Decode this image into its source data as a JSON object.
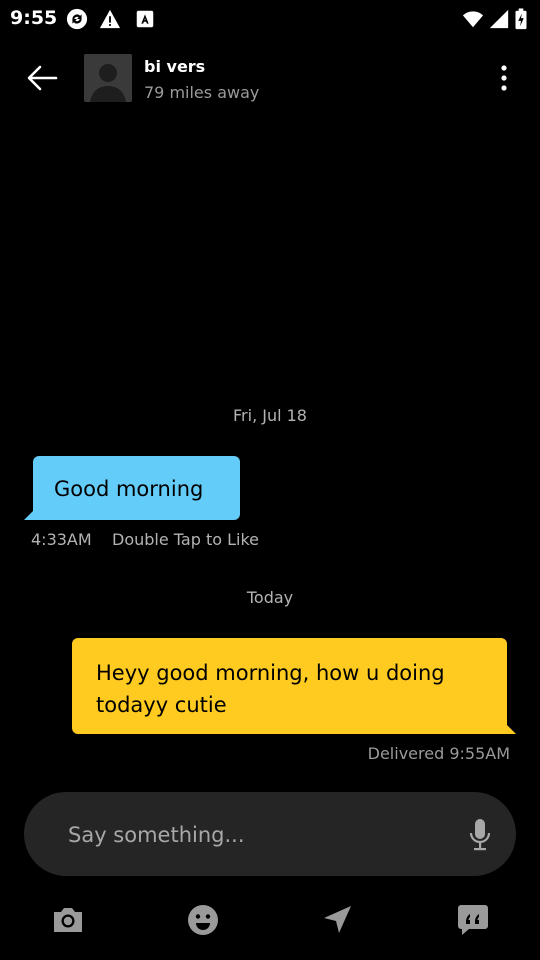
{
  "status_bar": {
    "time": "9:55",
    "icons": [
      "sync-icon",
      "warning-icon",
      "a-badge-icon",
      "wifi-icon",
      "signal-icon",
      "battery-icon"
    ]
  },
  "header": {
    "name": "bi vers",
    "distance": "79 miles away",
    "icons": [
      "back-arrow-icon",
      "avatar-silhouette-icon",
      "more-vert-icon"
    ]
  },
  "chat": {
    "messages": [
      {
        "date_separator": "Fri, Jul 18",
        "direction": "incoming",
        "text": "Good morning",
        "time": "4:33AM",
        "hint": "Double Tap to Like",
        "bubble_color": "#64ccf8"
      },
      {
        "date_separator": "Today",
        "direction": "outgoing",
        "text": "Heyy good morning, how u doing todayy cutie",
        "status": "Delivered 9:55AM",
        "bubble_color": "#ffcb21"
      }
    ]
  },
  "composer": {
    "placeholder": "Say something...",
    "icons": [
      "microphone-icon"
    ]
  },
  "toolbar": {
    "icons": [
      "camera-icon",
      "emoji-icon",
      "location-arrow-icon",
      "saved-phrases-icon"
    ]
  }
}
